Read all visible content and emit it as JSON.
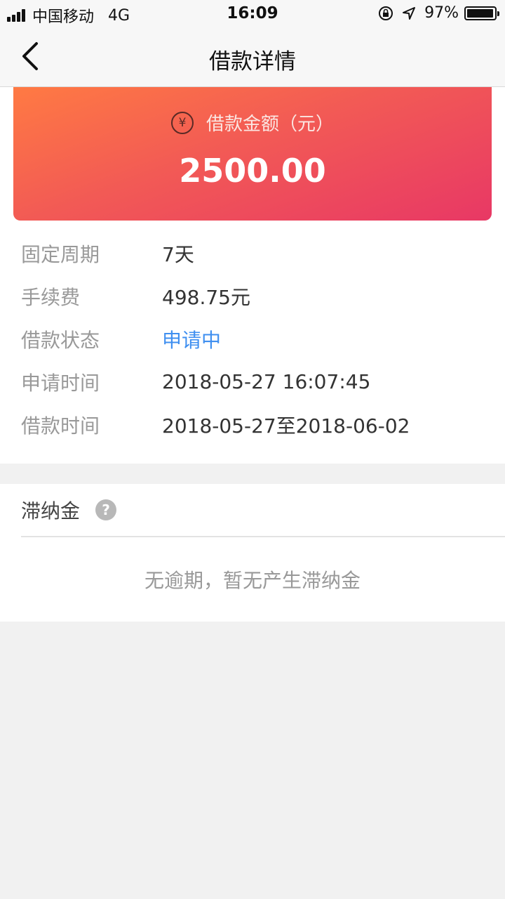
{
  "status_bar": {
    "carrier": "中国移动",
    "network": "4G",
    "time": "16:09",
    "battery_percent": "97%",
    "battery_level": 0.97
  },
  "nav": {
    "title": "借款详情"
  },
  "amount_card": {
    "currency_symbol": "¥",
    "label": "借款金额（元）",
    "value": "2500.00"
  },
  "details": [
    {
      "label": "固定周期",
      "value": "7天"
    },
    {
      "label": "手续费",
      "value": "498.75元"
    },
    {
      "label": "借款状态",
      "value": "申请中"
    },
    {
      "label": "申请时间",
      "value": "2018-05-27 16:07:45"
    },
    {
      "label": "借款时间",
      "value": "2018-05-27至2018-06-02"
    }
  ],
  "late_fee": {
    "title": "滞纳金",
    "help_symbol": "?",
    "empty_text": "无逾期，暂无产生滞纳金"
  },
  "colors": {
    "status_highlight": "#3f8ff0",
    "gradient_start": "#ff7a43",
    "gradient_end": "#e83865"
  }
}
